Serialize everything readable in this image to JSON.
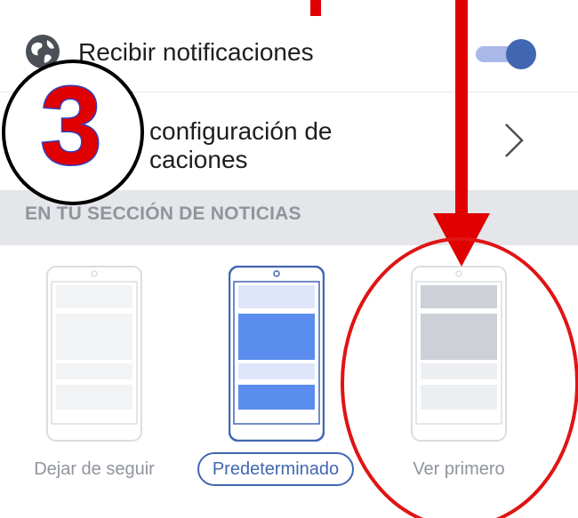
{
  "notifications": {
    "label": "Recibir notificaciones",
    "icon": "globe-icon",
    "toggle_on": true,
    "accent": "#4267b2"
  },
  "config": {
    "label": "configuración de\ncaciones",
    "icon": "chevron-right-icon"
  },
  "section": {
    "title": "EN TU SECCIÓN DE NOTICIAS"
  },
  "feed_options": [
    {
      "label": "Dejar de seguir",
      "selected": false
    },
    {
      "label": "Predeterminado",
      "selected": true
    },
    {
      "label": "Ver primero",
      "selected": false
    }
  ],
  "annotations": {
    "step_number": "3",
    "colors": {
      "marker": "#e00000",
      "circle": "#e01414"
    }
  }
}
